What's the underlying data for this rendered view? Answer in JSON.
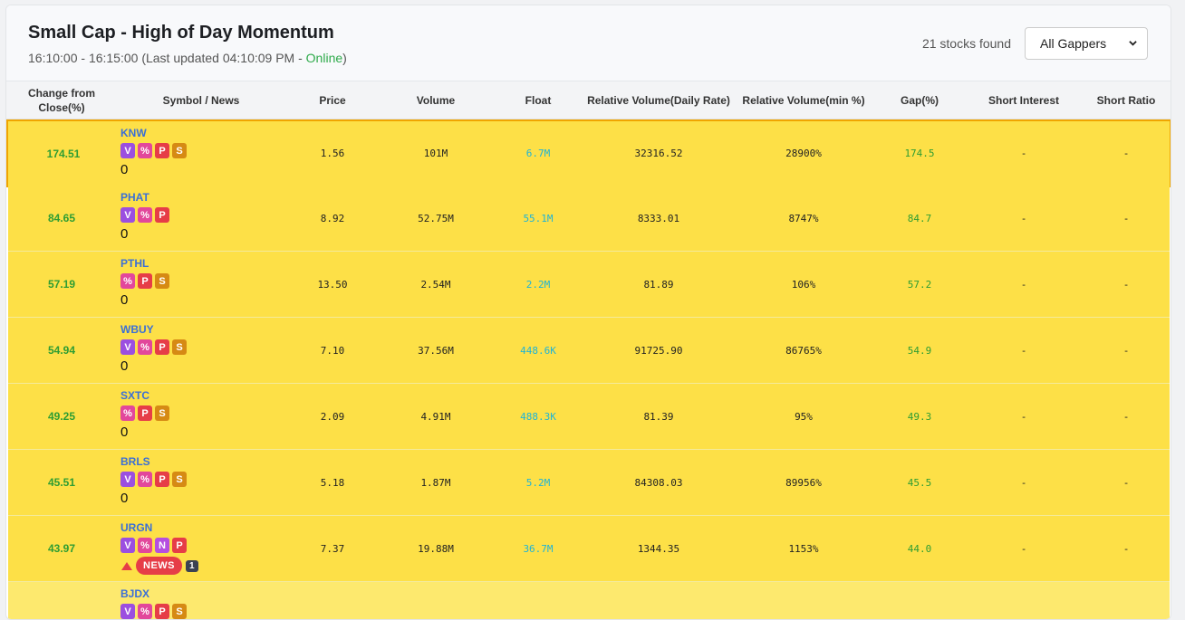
{
  "header": {
    "title": "Small Cap - High of Day Momentum",
    "time_range": "16:10:00 - 16:15:00 (Last updated 04:10:09 PM -",
    "status": "Online",
    "status_close": ")",
    "count": "21 stocks found",
    "filter_value": "All Gappers"
  },
  "columns": [
    "Change from Close(%)",
    "Symbol / News",
    "Price",
    "Volume",
    "Float",
    "Relative Volume(Daily Rate)",
    "Relative Volume(min %)",
    "Gap(%)",
    "Short Interest",
    "Short Ratio"
  ],
  "colors": {
    "row_highlight": "#fde047",
    "selected_border": "#f0a500",
    "green": "#2e9d33",
    "float_blue": "#1fb4d6",
    "symbol_blue": "#3b6fd6"
  },
  "rows": [
    {
      "change": "174.51",
      "symbol": "KNW",
      "badges": [
        "V",
        "%",
        "P",
        "S"
      ],
      "news_value": "0",
      "price": "1.56",
      "volume": "101M",
      "float": "6.7M",
      "rv_daily": "32316.52",
      "rv_min": "28900%",
      "gap": "174.5",
      "short_interest": "-",
      "short_ratio": "-"
    },
    {
      "change": "84.65",
      "symbol": "PHAT",
      "badges": [
        "V",
        "%",
        "P"
      ],
      "news_value": "0",
      "price": "8.92",
      "volume": "52.75M",
      "float": "55.1M",
      "rv_daily": "8333.01",
      "rv_min": "8747%",
      "gap": "84.7",
      "short_interest": "-",
      "short_ratio": "-"
    },
    {
      "change": "57.19",
      "symbol": "PTHL",
      "badges": [
        "%",
        "P",
        "S"
      ],
      "news_value": "0",
      "price": "13.50",
      "volume": "2.54M",
      "float": "2.2M",
      "rv_daily": "81.89",
      "rv_min": "106%",
      "gap": "57.2",
      "short_interest": "-",
      "short_ratio": "-"
    },
    {
      "change": "54.94",
      "symbol": "WBUY",
      "badges": [
        "V",
        "%",
        "P",
        "S"
      ],
      "news_value": "0",
      "price": "7.10",
      "volume": "37.56M",
      "float": "448.6K",
      "rv_daily": "91725.90",
      "rv_min": "86765%",
      "gap": "54.9",
      "short_interest": "-",
      "short_ratio": "-"
    },
    {
      "change": "49.25",
      "symbol": "SXTC",
      "badges": [
        "%",
        "P",
        "S"
      ],
      "news_value": "0",
      "price": "2.09",
      "volume": "4.91M",
      "float": "488.3K",
      "rv_daily": "81.39",
      "rv_min": "95%",
      "gap": "49.3",
      "short_interest": "-",
      "short_ratio": "-"
    },
    {
      "change": "45.51",
      "symbol": "BRLS",
      "badges": [
        "V",
        "%",
        "P",
        "S"
      ],
      "news_value": "0",
      "price": "5.18",
      "volume": "1.87M",
      "float": "5.2M",
      "rv_daily": "84308.03",
      "rv_min": "89956%",
      "gap": "45.5",
      "short_interest": "-",
      "short_ratio": "-"
    },
    {
      "change": "43.97",
      "symbol": "URGN",
      "badges": [
        "V",
        "%",
        "N",
        "P"
      ],
      "news_label": "NEWS",
      "news_count": "1",
      "price": "7.37",
      "volume": "19.88M",
      "float": "36.7M",
      "rv_daily": "1344.35",
      "rv_min": "1153%",
      "gap": "44.0",
      "short_interest": "-",
      "short_ratio": "-"
    },
    {
      "change": "",
      "symbol": "BJDX",
      "badges": [
        "V",
        "%",
        "P",
        "S"
      ],
      "news_value": "",
      "price": "",
      "volume": "",
      "float": "",
      "rv_daily": "",
      "rv_min": "",
      "gap": "",
      "short_interest": "",
      "short_ratio": ""
    }
  ]
}
